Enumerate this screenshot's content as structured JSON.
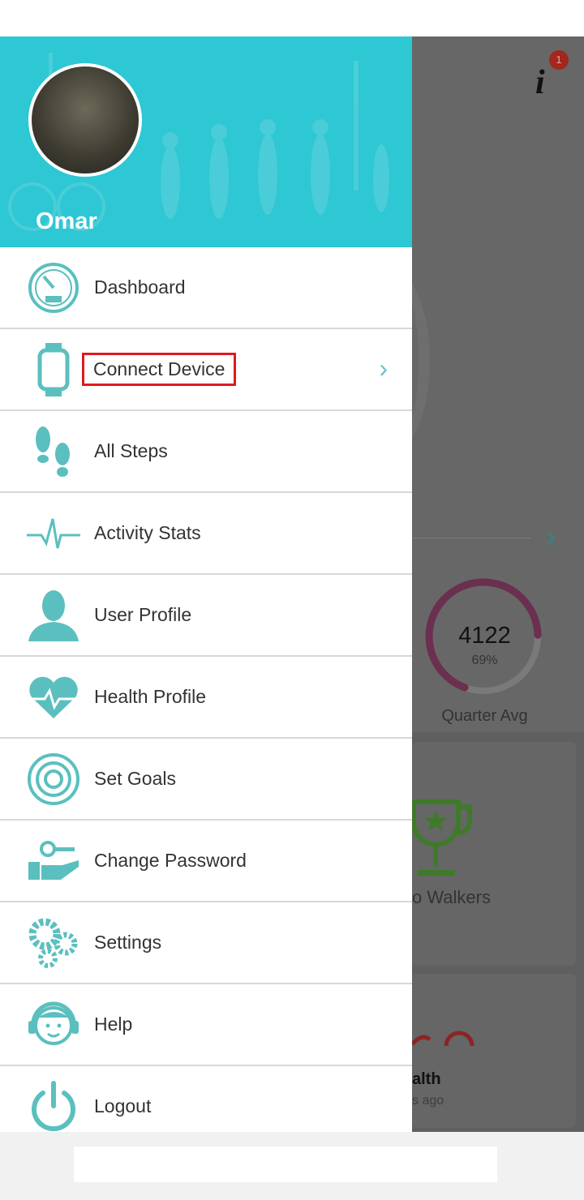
{
  "user": {
    "name": "Omar"
  },
  "menu": [
    {
      "label": "Dashboard",
      "icon": "dashboard-gauge-icon"
    },
    {
      "label": "Connect Device",
      "icon": "smartwatch-icon",
      "highlighted": true,
      "has_chevron": true
    },
    {
      "label": "All Steps",
      "icon": "footprints-icon"
    },
    {
      "label": "Activity Stats",
      "icon": "pulse-line-icon"
    },
    {
      "label": "User Profile",
      "icon": "user-silhouette-icon"
    },
    {
      "label": "Health Profile",
      "icon": "heart-pulse-icon"
    },
    {
      "label": "Set Goals",
      "icon": "target-icon"
    },
    {
      "label": "Change Password",
      "icon": "key-hand-icon"
    },
    {
      "label": "Settings",
      "icon": "gears-icon"
    },
    {
      "label": "Help",
      "icon": "support-headset-icon"
    },
    {
      "label": "Logout",
      "icon": "power-icon"
    }
  ],
  "background": {
    "notification_count": "1",
    "quarter_avg_value": "4122",
    "quarter_avg_percent": "69%",
    "quarter_avg_progress": 0.69,
    "quarter_avg_label": "Quarter Avg",
    "walkers_label": "o Walkers",
    "health_label": "alth",
    "health_time": "s ago"
  },
  "colors": {
    "accent": "#2ec7d4",
    "icon": "#5bbfbf",
    "highlight": "#e0191f",
    "overlay": "#676767",
    "ring": "#6b2f4f"
  }
}
